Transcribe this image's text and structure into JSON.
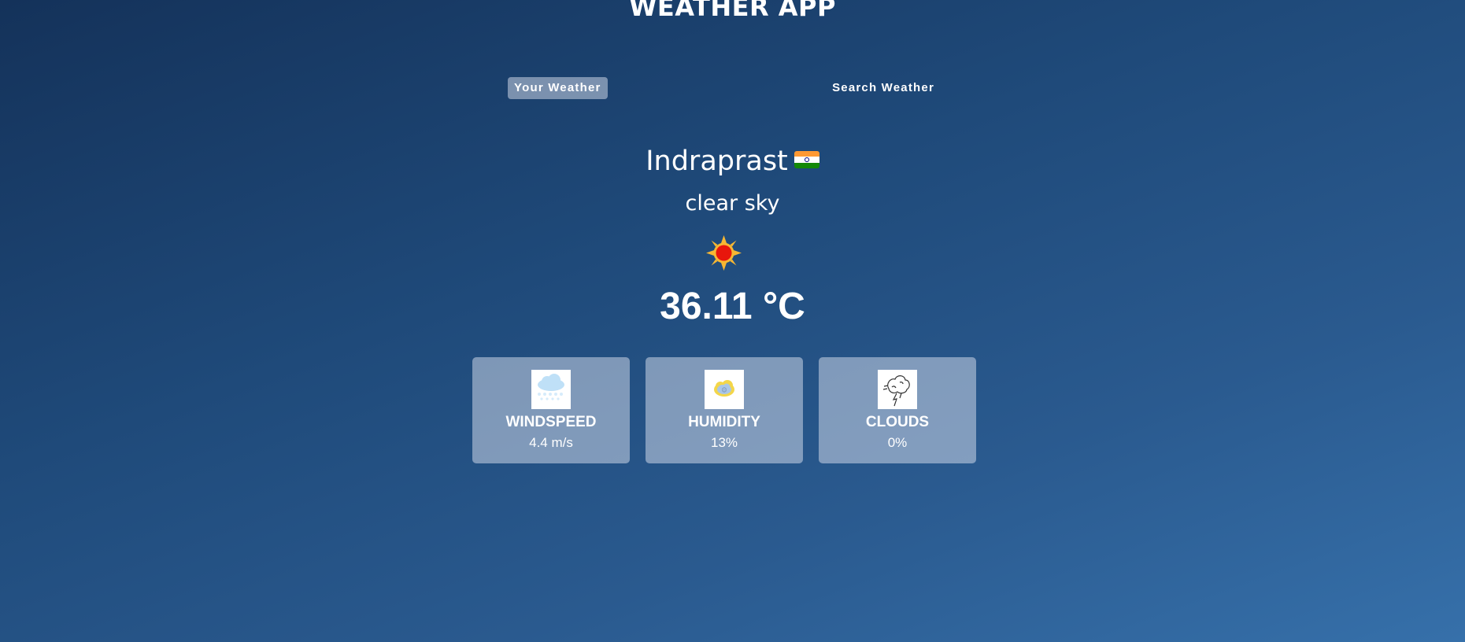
{
  "app": {
    "title": "WEATHER APP"
  },
  "tabs": [
    {
      "label": "Your Weather",
      "active": true
    },
    {
      "label": "Search Weather",
      "active": false
    }
  ],
  "location": {
    "city": "Indraprast",
    "country_flag": "india-flag-icon"
  },
  "weather": {
    "description": "clear sky",
    "icon": "sun-icon",
    "temperature": "36.11 °C"
  },
  "stats": [
    {
      "label": "WINDSPEED",
      "value": "4.4 m/s",
      "icon": "wind-cloud-icon"
    },
    {
      "label": "HUMIDITY",
      "value": "13%",
      "icon": "humidity-icon"
    },
    {
      "label": "CLOUDS",
      "value": "0%",
      "icon": "cloud-icon"
    }
  ],
  "colors": {
    "background_top": "#14325a",
    "background_bottom": "#3670aa",
    "card_bg": "rgba(219,226,239,0.5)",
    "text": "#ffffff"
  }
}
